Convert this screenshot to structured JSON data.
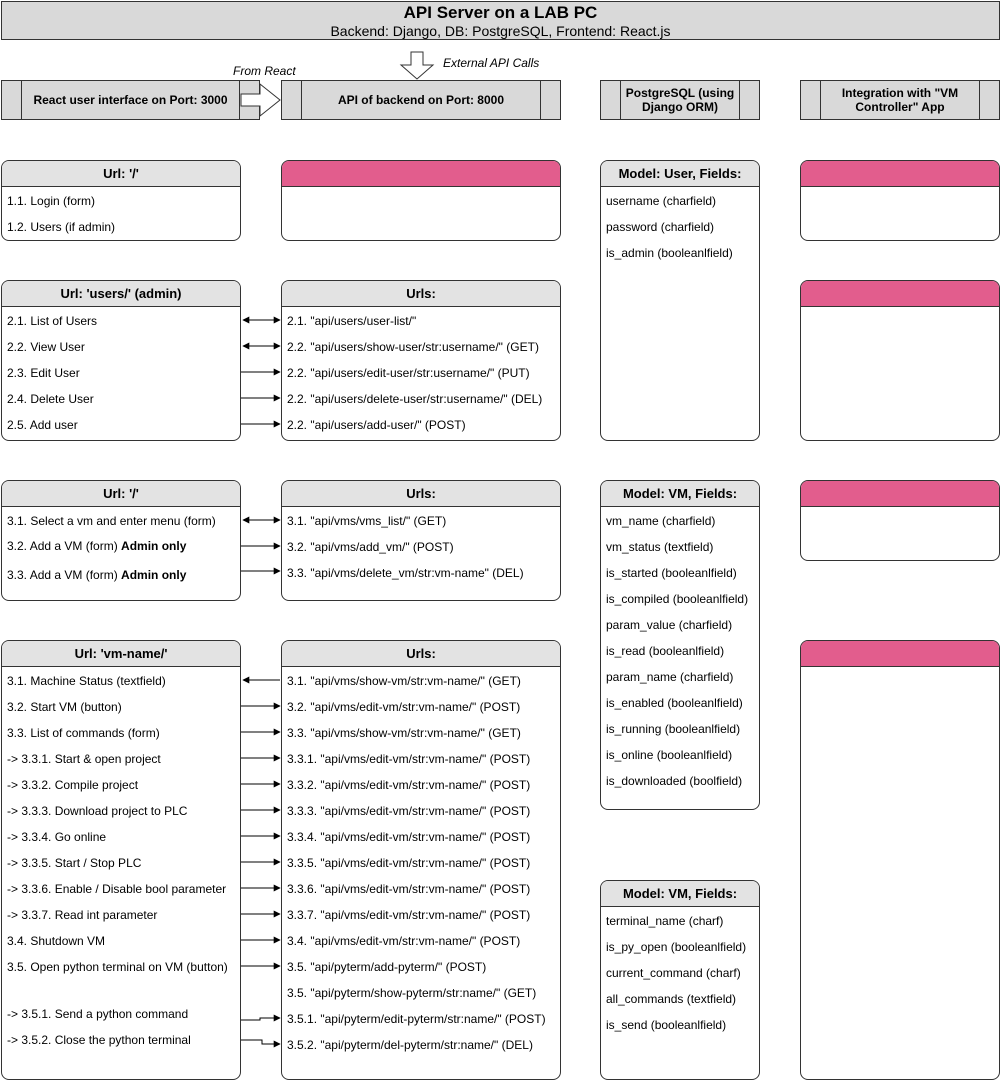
{
  "title": "API Server on a LAB PC",
  "subtitle": "Backend: Django, DB: PostgreSQL, Frontend: React.js",
  "annotations": {
    "from_react": "From React",
    "external_api": "External API Calls"
  },
  "columns": {
    "frontend": "React user interface on Port: 3000",
    "backend": "API of backend on Port: 8000",
    "database": "PostgreSQL (using Django ORM)",
    "integration": "Integration with \"VM Controller\" App"
  },
  "frontend": {
    "root": {
      "title": "Url: '/'",
      "items": [
        "1.1. Login (form)",
        "1.2. Users (if admin)"
      ]
    },
    "users": {
      "title": "Url: 'users/' (admin)",
      "items": [
        "2.1. List of Users",
        "2.2. View User",
        "2.3. Edit User",
        "2.4. Delete User",
        "2.5. Add user"
      ]
    },
    "vms": {
      "title": "Url: '/'",
      "items": [
        {
          "text": "3.1. Select a vm and enter menu (form)",
          "bold": ""
        },
        {
          "text": "3.2. Add a VM (form) ",
          "bold": "Admin only"
        },
        {
          "text": "3.3. Add a VM (form) ",
          "bold": "Admin only"
        }
      ]
    },
    "vm_name": {
      "title": "Url: 'vm-name/'",
      "items": [
        "3.1. Machine Status (textfield)",
        "3.2. Start VM (button)",
        "3.3. List of commands (form)",
        "-> 3.3.1. Start & open project",
        "-> 3.3.2. Compile project",
        "-> 3.3.3. Download project to PLC",
        "-> 3.3.4. Go online",
        "-> 3.3.5. Start / Stop PLC",
        "-> 3.3.6. Enable / Disable bool parameter",
        "-> 3.3.7. Read int parameter",
        "3.4. Shutdown VM",
        "3.5. Open python terminal on VM (button)",
        "-> 3.5.1. Send a python command",
        "-> 3.5.2. Close the python terminal"
      ]
    }
  },
  "backend": {
    "users_urls": {
      "title": "Urls:",
      "items": [
        "2.1. \"api/users/user-list/\"",
        "2.2. \"api/users/show-user/str:username/\" (GET)",
        "2.2. \"api/users/edit-user/str:username/\" (PUT)",
        "2.2. \"api/users/delete-user/str:username/\" (DEL)",
        "2.2. \"api/users/add-user/\" (POST)"
      ]
    },
    "vms_urls": {
      "title": "Urls:",
      "items": [
        "3.1. \"api/vms/vms_list/\" (GET)",
        "3.2. \"api/vms/add_vm/\" (POST)",
        "3.3. \"api/vms/delete_vm/str:vm-name\" (DEL)"
      ]
    },
    "vm_name_urls": {
      "title": "Urls:",
      "items": [
        "3.1. \"api/vms/show-vm/str:vm-name/\" (GET)",
        "3.2. \"api/vms/edit-vm/str:vm-name/\" (POST)",
        "3.3. \"api/vms/show-vm/str:vm-name/\" (GET)",
        "3.3.1. \"api/vms/edit-vm/str:vm-name/\" (POST)",
        "3.3.2. \"api/vms/edit-vm/str:vm-name/\" (POST)",
        "3.3.3. \"api/vms/edit-vm/str:vm-name/\" (POST)",
        "3.3.4. \"api/vms/edit-vm/str:vm-name/\" (POST)",
        "3.3.5. \"api/vms/edit-vm/str:vm-name/\" (POST)",
        "3.3.6. \"api/vms/edit-vm/str:vm-name/\" (POST)",
        "3.3.7. \"api/vms/edit-vm/str:vm-name/\" (POST)",
        "3.4. \"api/vms/edit-vm/str:vm-name/\" (POST)",
        "3.5. \"api/pyterm/add-pyterm/\" (POST)",
        "3.5. \"api/pyterm/show-pyterm/str:name/\" (GET)",
        "3.5.1. \"api/pyterm/edit-pyterm/str:name/\" (POST)",
        "3.5.2. \"api/pyterm/del-pyterm/str:name/\" (DEL)"
      ]
    }
  },
  "database": {
    "user_model": {
      "title": "Model: User, Fields:",
      "fields": [
        "username (charfield)",
        "password (charfield)",
        "is_admin (booleanlfield)"
      ]
    },
    "vm_model": {
      "title": "Model: VM, Fields:",
      "fields": [
        "vm_name (charfield)",
        "vm_status (textfield)",
        "is_started (booleanlfield)",
        "is_compiled (booleanlfield)",
        "param_value (charfield)",
        "is_read (booleanlfield)",
        "param_name (charfield)",
        "is_enabled (booleanlfield)",
        "is_running (booleanlfield)",
        "is_online (booleanlfield)",
        "is_downloaded (boolfield)"
      ]
    },
    "vm_model_2": {
      "title": "Model: VM, Fields:",
      "fields": [
        "terminal_name (charf)",
        "is_py_open (booleanlfield)",
        "current_command (charf)",
        "all_commands (textfield)",
        "is_send (booleanlfield)"
      ]
    }
  },
  "colors": {
    "header_fill": "#d9d9d9",
    "card_header_fill": "#e3e3e3",
    "accent_pink": "#e25d8d",
    "stroke": "#333333"
  }
}
